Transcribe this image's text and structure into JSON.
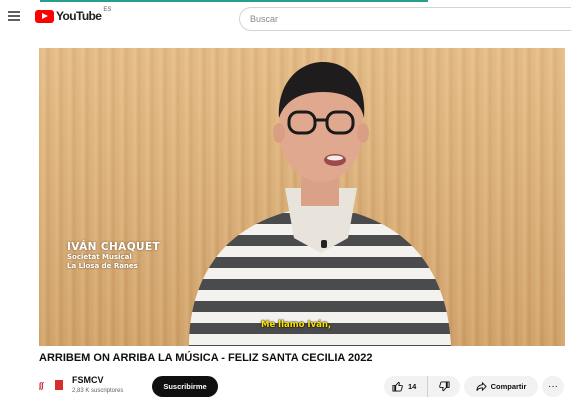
{
  "header": {
    "logo_text": "YouTube",
    "logo_country": "ES",
    "search_placeholder": "Buscar"
  },
  "video": {
    "name_card": {
      "name": "IVÁN CHAQUET",
      "line1": "Societat Musical",
      "line2": "La Llosa de Ranes"
    },
    "subtitle": "Me llamo Iván,"
  },
  "title": "ARRIBEM ON ARRIBA LA MÚSICA - FELIZ SANTA CECILIA 2022",
  "channel": {
    "name": "FSMCV",
    "subscribers": "2,83 K suscriptores",
    "subscribe_label": "Suscribirme"
  },
  "actions": {
    "like_count": "14",
    "share_label": "Compartir",
    "more_label": "···"
  },
  "colors": {
    "brand_red": "#ff0000",
    "subtitle_yellow": "#ffe400",
    "accent_line": "#2a9d8f"
  }
}
